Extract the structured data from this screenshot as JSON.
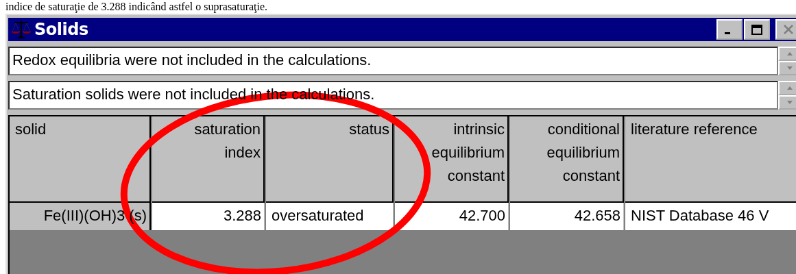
{
  "caption": "indice de saturaţie de 3.288 indicând astfel o suprasaturaţie.",
  "window": {
    "title": "Solids",
    "title_buttons": [
      {
        "kind": "minimize",
        "disabled": false
      },
      {
        "kind": "maximize",
        "disabled": false
      },
      {
        "kind": "close",
        "disabled": true
      }
    ]
  },
  "messages": [
    "Redox equilibria were not included in the calculations.",
    "Saturation solids were not included in the calculations."
  ],
  "table": {
    "columns": [
      "solid",
      "saturation index",
      "status",
      "intrinsic equilibrium constant",
      "conditional equilibrium constant",
      "literature reference"
    ],
    "rows": [
      [
        "Fe(III)(OH)3 (s)",
        "3.288",
        "oversaturated",
        "42.700",
        "42.658",
        "NIST Database 46 V"
      ]
    ]
  }
}
